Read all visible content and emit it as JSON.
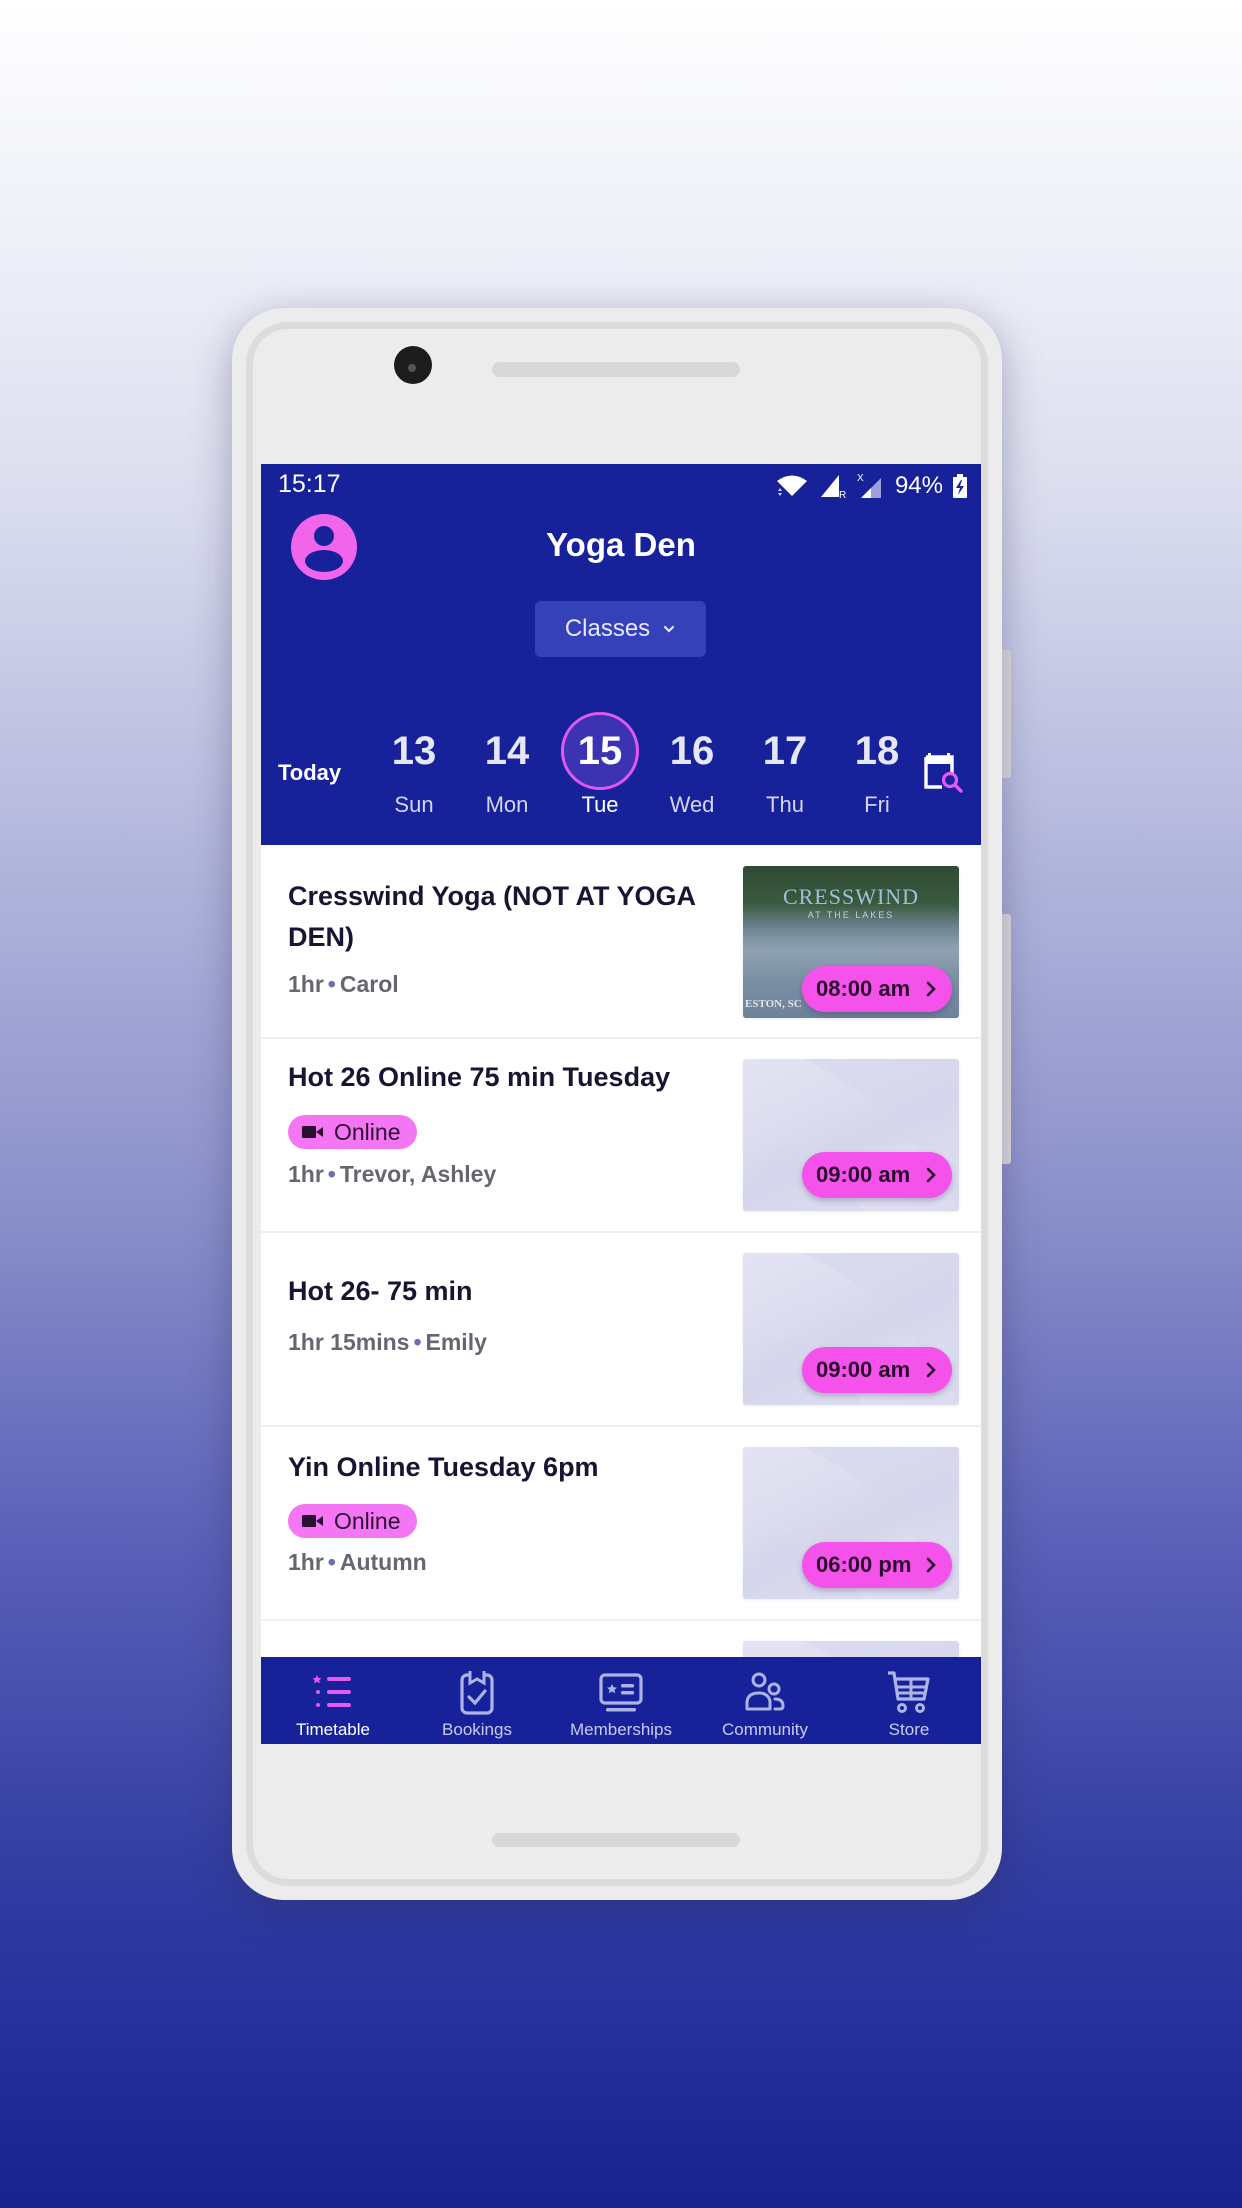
{
  "status_bar": {
    "time": "15:17",
    "battery": "94%",
    "icons": [
      "wifi-icon",
      "signal-roaming-icon",
      "signal-icon",
      "battery-charging-icon"
    ]
  },
  "header": {
    "title": "Yoga Den",
    "avatar_icon": "user-avatar-icon",
    "dropdown": {
      "selected": "Classes",
      "icon": "chevron-down-icon"
    },
    "today_label": "Today",
    "dates": [
      {
        "num": "13",
        "day": "Sun",
        "selected": false
      },
      {
        "num": "14",
        "day": "Mon",
        "selected": false
      },
      {
        "num": "15",
        "day": "Tue",
        "selected": true
      },
      {
        "num": "16",
        "day": "Wed",
        "selected": false
      },
      {
        "num": "17",
        "day": "Thu",
        "selected": false
      },
      {
        "num": "18",
        "day": "Fri",
        "selected": false
      }
    ],
    "calendar_search_icon": "calendar-search-icon"
  },
  "classes": [
    {
      "title": "Cresswind Yoga (NOT AT YOGA DEN)",
      "duration": "1hr",
      "instructor": "Carol",
      "online": false,
      "time": "08:00 am",
      "image": {
        "brand": "CRESSWIND",
        "sub": "AT THE LAKES",
        "location": "ESTON, SC"
      }
    },
    {
      "title": "Hot 26 Online 75 min Tuesday",
      "duration": "1hr",
      "instructor": "Trevor, Ashley",
      "online": true,
      "badge": "Online",
      "time": "09:00 am"
    },
    {
      "title": "Hot 26- 75 min",
      "duration": "1hr 15mins",
      "instructor": "Emily",
      "online": false,
      "time": "09:00 am"
    },
    {
      "title": "Yin Online Tuesday 6pm",
      "duration": "1hr",
      "instructor": "Autumn",
      "online": true,
      "badge": "Online",
      "time": "06:00 pm"
    }
  ],
  "separator": "•",
  "bottom_nav": [
    {
      "label": "Timetable",
      "icon": "timetable-icon",
      "active": true
    },
    {
      "label": "Bookings",
      "icon": "bookings-clipboard-icon",
      "active": false
    },
    {
      "label": "Memberships",
      "icon": "membership-card-icon",
      "active": false
    },
    {
      "label": "Community",
      "icon": "community-users-icon",
      "active": false
    },
    {
      "label": "Store",
      "icon": "store-cart-icon",
      "active": false
    }
  ],
  "colors": {
    "brand": "#17229a",
    "accent": "#f452ea",
    "accent_light": "#f476f4",
    "selected_ring": "#e05af0"
  }
}
